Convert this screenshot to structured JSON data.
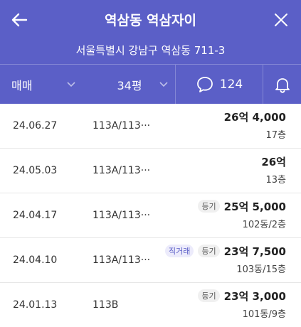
{
  "header": {
    "title": "역삼동 역삼자이",
    "address": "서울특별시 강남구 역삼동 711-3"
  },
  "filters": {
    "trade_type": "매매",
    "size": "34평",
    "comment_count": "124"
  },
  "transactions": [
    {
      "date": "24.06.27",
      "area": "113A/113···",
      "badges": [],
      "price": "26억 4,000",
      "floor": "17층"
    },
    {
      "date": "24.05.03",
      "area": "113A/113···",
      "badges": [],
      "price": "26억",
      "floor": "13층"
    },
    {
      "date": "24.04.17",
      "area": "113A/113···",
      "badges": [
        "등기"
      ],
      "price": "25억 5,000",
      "floor": "102동/2층"
    },
    {
      "date": "24.04.10",
      "area": "113A/113···",
      "badges": [
        "직거래",
        "등기"
      ],
      "price": "23억 7,500",
      "floor": "103동/15층"
    },
    {
      "date": "24.01.13",
      "area": "113B",
      "badges": [
        "등기"
      ],
      "price": "23억 3,000",
      "floor": "101동/9층"
    }
  ],
  "colors": {
    "header_bg": "#5b5fc7",
    "badge_direct": "#5b5fc7"
  }
}
